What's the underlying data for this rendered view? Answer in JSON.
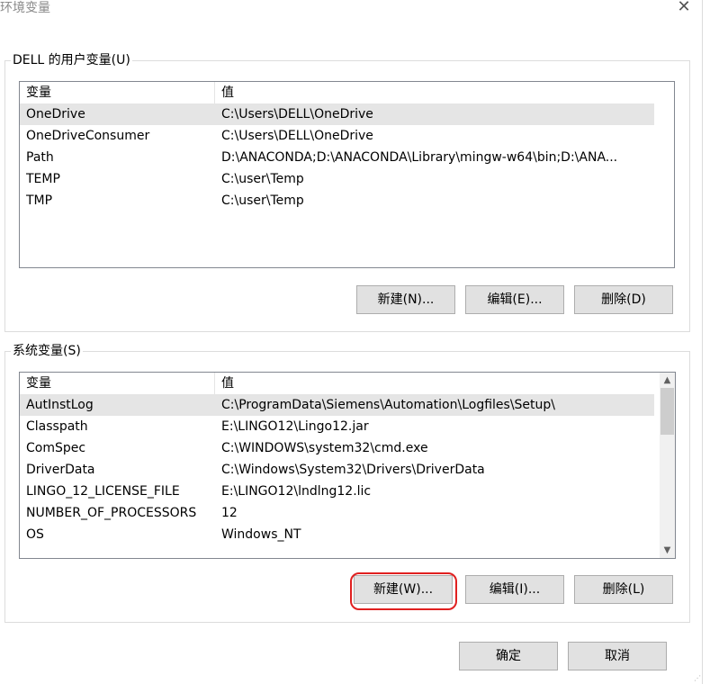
{
  "window": {
    "title": "环境变量",
    "close_label": "✕"
  },
  "user_group": {
    "legend": "DELL 的用户变量(U)",
    "columns": [
      "变量",
      "值"
    ],
    "rows": [
      {
        "name": "OneDrive",
        "value": "C:\\Users\\DELL\\OneDrive"
      },
      {
        "name": "OneDriveConsumer",
        "value": "C:\\Users\\DELL\\OneDrive"
      },
      {
        "name": "Path",
        "value": "D:\\ANACONDA;D:\\ANACONDA\\Library\\mingw-w64\\bin;D:\\ANA..."
      },
      {
        "name": "TEMP",
        "value": "C:\\user\\Temp"
      },
      {
        "name": "TMP",
        "value": "C:\\user\\Temp"
      }
    ],
    "selected_index": 0,
    "buttons": {
      "new": "新建(N)...",
      "edit": "编辑(E)...",
      "delete": "删除(D)"
    }
  },
  "system_group": {
    "legend": "系统变量(S)",
    "columns": [
      "变量",
      "值"
    ],
    "rows": [
      {
        "name": "AutInstLog",
        "value": "C:\\ProgramData\\Siemens\\Automation\\Logfiles\\Setup\\"
      },
      {
        "name": "Classpath",
        "value": "E:\\LINGO12\\Lingo12.jar"
      },
      {
        "name": "ComSpec",
        "value": "C:\\WINDOWS\\system32\\cmd.exe"
      },
      {
        "name": "DriverData",
        "value": "C:\\Windows\\System32\\Drivers\\DriverData"
      },
      {
        "name": "LINGO_12_LICENSE_FILE",
        "value": "E:\\LINGO12\\lndlng12.lic"
      },
      {
        "name": "NUMBER_OF_PROCESSORS",
        "value": "12"
      },
      {
        "name": "OS",
        "value": "Windows_NT"
      }
    ],
    "selected_index": 0,
    "buttons": {
      "new": "新建(W)...",
      "edit": "编辑(I)...",
      "delete": "删除(L)"
    }
  },
  "footer": {
    "ok": "确定",
    "cancel": "取消"
  },
  "scrollbar": {
    "up_icon": "chevron-up",
    "down_icon": "chevron-down"
  },
  "colors": {
    "annotation": "#e02020",
    "selection": "#e5e5e5",
    "button": "#e1e1e1"
  }
}
